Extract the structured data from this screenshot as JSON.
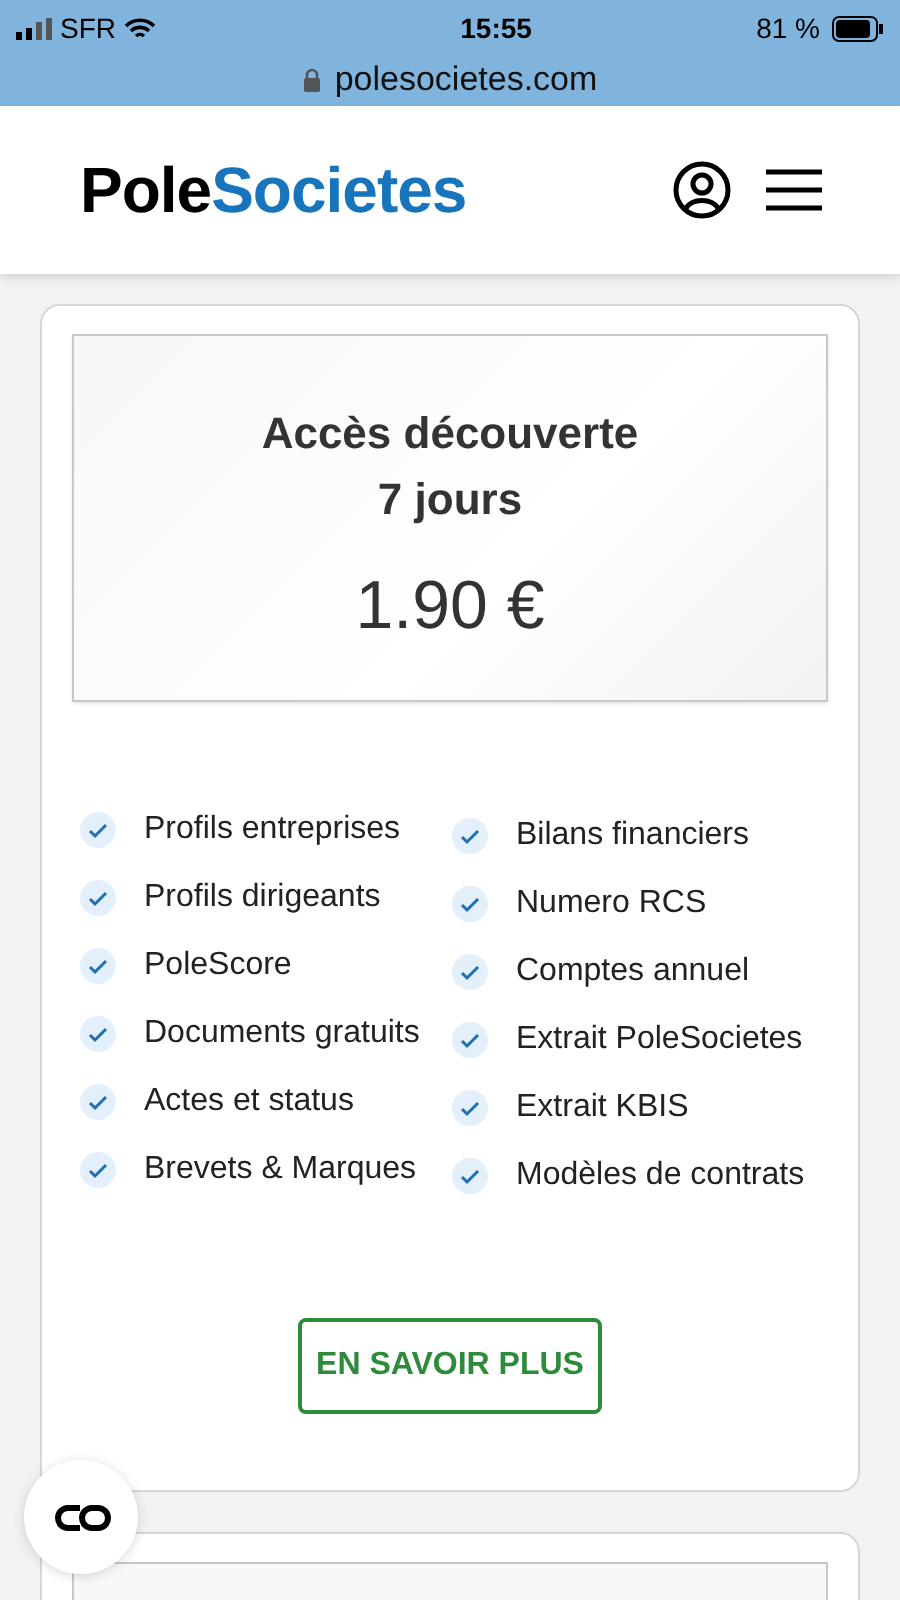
{
  "status_bar": {
    "carrier": "SFR",
    "time": "15:55",
    "battery": "81 %",
    "url": "polesocietes.com"
  },
  "header": {
    "logo_first": "Pole",
    "logo_second": "Societes"
  },
  "offer": {
    "title_line_1": "Accès découverte",
    "title_line_2": "7 jours",
    "price": "1.90 €",
    "features_left": [
      "Profils entreprises",
      "Profils dirigeants",
      "PoleScore",
      "Documents gratuits",
      "Actes et status",
      "Brevets & Marques"
    ],
    "features_right": [
      "Bilans financiers",
      "Numero RCS",
      "Comptes annuel",
      "Extrait PoleSocietes",
      "Extrait KBIS",
      "Modèles de contrats"
    ],
    "button": "EN SAVOIR PLUS"
  }
}
